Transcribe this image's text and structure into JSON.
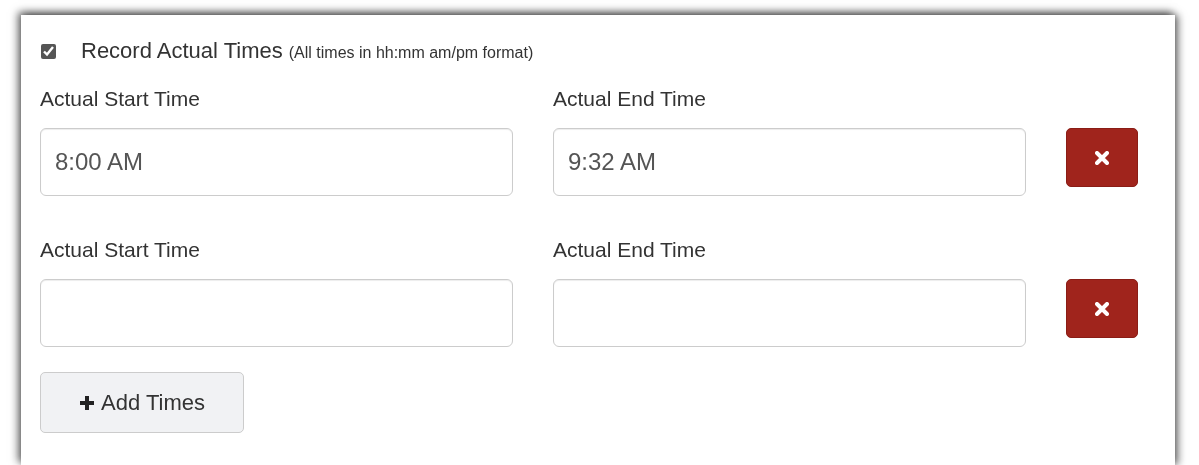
{
  "record_actual_times": {
    "checked": true,
    "label": "Record Actual Times",
    "note": "(All times in hh:mm am/pm format)"
  },
  "time_rows": [
    {
      "start_label": "Actual Start Time",
      "start_value": "8:00 AM",
      "end_label": "Actual End Time",
      "end_value": "9:32 AM"
    },
    {
      "start_label": "Actual Start Time",
      "start_value": "",
      "end_label": "Actual End Time",
      "end_value": ""
    }
  ],
  "add_button": {
    "label": "Add Times"
  }
}
